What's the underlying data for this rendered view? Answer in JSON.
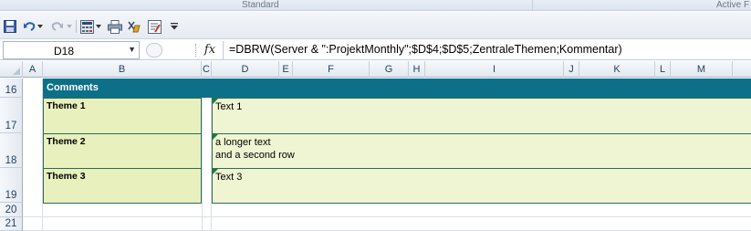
{
  "ribbon": {
    "group_standard": "Standard",
    "group_active": "Active F"
  },
  "toolbar": {
    "icons": [
      "save-icon",
      "undo-icon",
      "undo-dropdown-icon",
      "redo-icon",
      "redo-dropdown-icon",
      "calculate-icon",
      "calculate-dropdown-icon",
      "print-icon",
      "clear-icon",
      "form-icon",
      "customize-dropdown-icon"
    ]
  },
  "formula_bar": {
    "name_box": "D18",
    "fx_label": "fx",
    "formula": "=DBRW(Server & \":ProjektMonthly\";$D$4;$D$5;ZentraleThemen;Kommentar)"
  },
  "columns": [
    "A",
    "B",
    "C",
    "D",
    "E",
    "F",
    "G",
    "H",
    "I",
    "J",
    "K",
    "L",
    "M"
  ],
  "rows": [
    "16",
    "17",
    "18",
    "19",
    "20",
    "21"
  ],
  "sheet": {
    "comments_header": "Comments",
    "themes": [
      {
        "label": "Theme 1",
        "text_line1": "Text 1",
        "text_line2": ""
      },
      {
        "label": "Theme 2",
        "text_line1": "a longer text",
        "text_line2": "and a second row"
      },
      {
        "label": "Theme 3",
        "text_line1": "Text 3",
        "text_line2": ""
      }
    ]
  },
  "colors": {
    "header_bar": "#0e7088",
    "theme_fill": "#e8f0be",
    "text_fill": "#eff5d2",
    "cell_border": "#2c6e57"
  }
}
